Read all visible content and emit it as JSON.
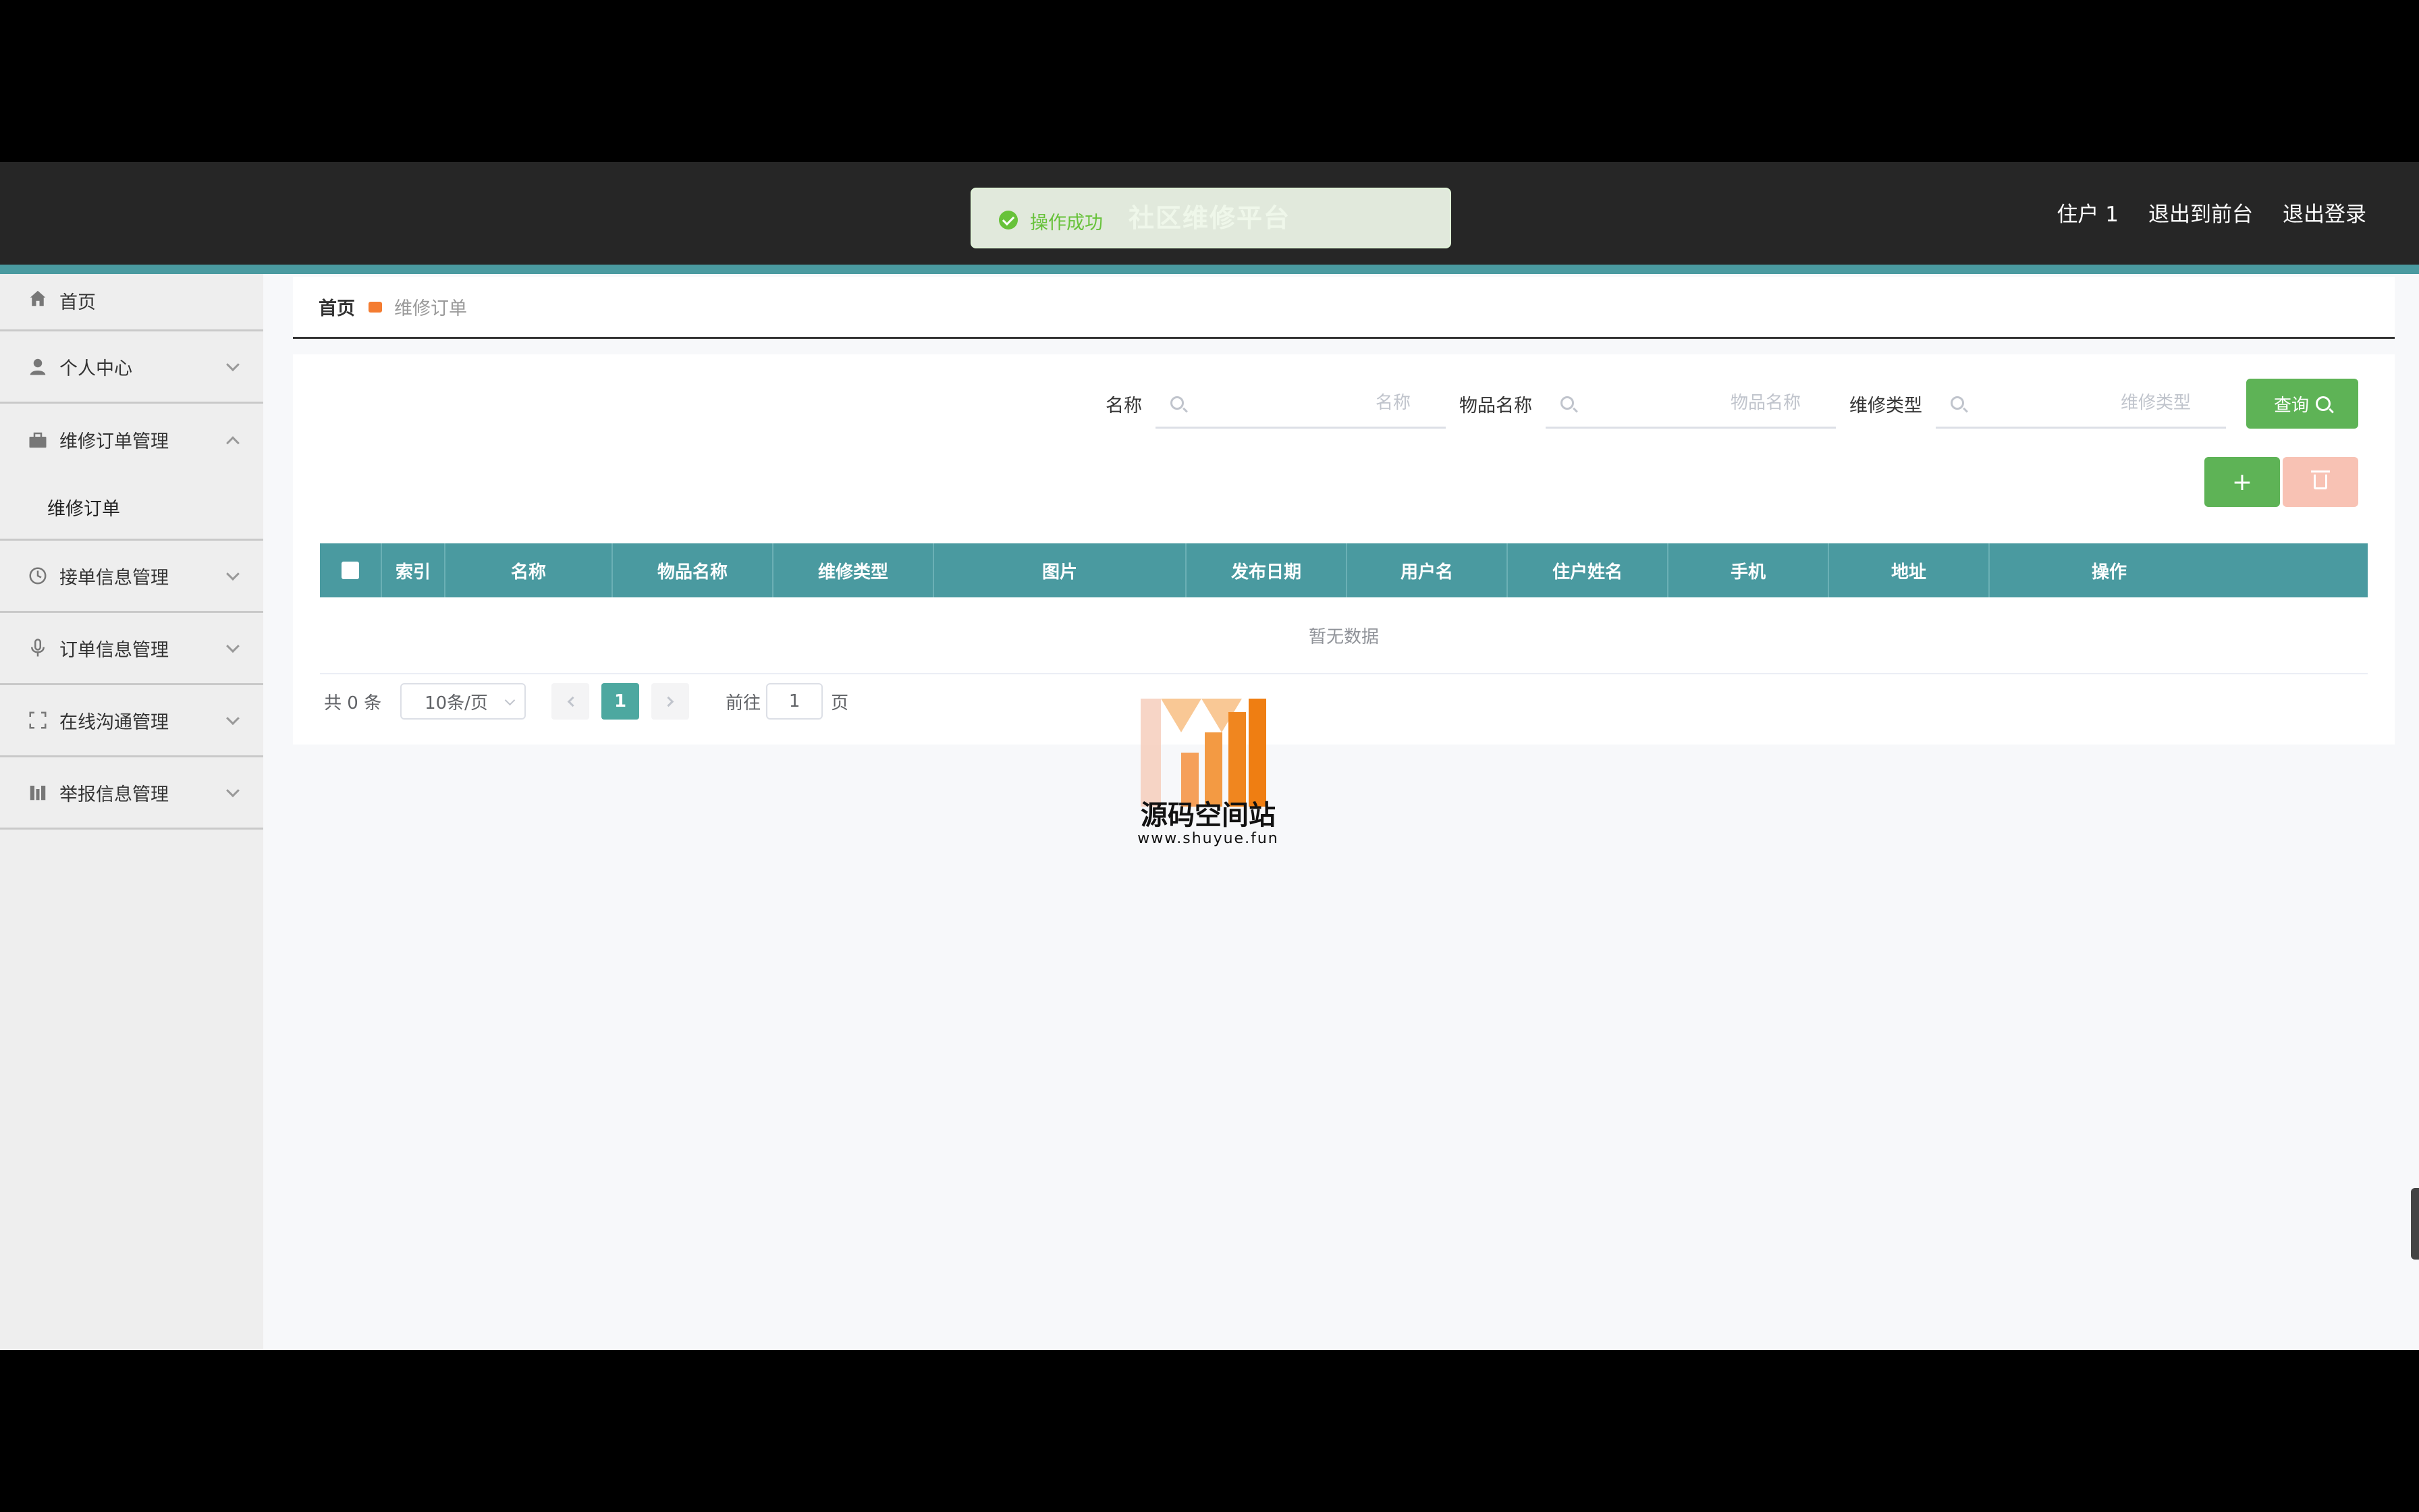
{
  "header": {
    "site_title": "社区维修平台",
    "links": [
      "住户 1",
      "退出到前台",
      "退出登录"
    ]
  },
  "toast": {
    "message": "操作成功",
    "color": "#67c23a"
  },
  "sidebar": {
    "items": [
      {
        "label": "首页",
        "icon": "home-icon"
      },
      {
        "label": "个人中心",
        "icon": "user-icon"
      },
      {
        "label": "维修订单管理",
        "icon": "briefcase-icon",
        "expanded": true,
        "children": [
          "维修订单"
        ]
      },
      {
        "label": "接单信息管理",
        "icon": "clock-icon"
      },
      {
        "label": "订单信息管理",
        "icon": "microphone-icon"
      },
      {
        "label": "在线沟通管理",
        "icon": "frame-icon"
      },
      {
        "label": "举报信息管理",
        "icon": "columns-icon"
      }
    ]
  },
  "breadcrumb": {
    "home": "首页",
    "current": "维修订单"
  },
  "search": {
    "fields": [
      {
        "label": "名称",
        "placeholder": "名称"
      },
      {
        "label": "物品名称",
        "placeholder": "物品名称"
      },
      {
        "label": "维修类型",
        "placeholder": "维修类型"
      }
    ],
    "query_label": "查询"
  },
  "actions": {
    "add_label": "+"
  },
  "table": {
    "columns": [
      "索引",
      "名称",
      "物品名称",
      "维修类型",
      "图片",
      "发布日期",
      "用户名",
      "住户姓名",
      "手机",
      "地址",
      "操作"
    ],
    "empty_text": "暂无数据"
  },
  "pagination": {
    "total_text": "共 0 条",
    "page_size": "10条/页",
    "current_page": "1",
    "goto_label": "前往",
    "goto_value": "1",
    "page_suffix": "页"
  },
  "watermark": {
    "name": "源码空间站",
    "url": "www.shuyue.fun"
  },
  "colors": {
    "header_bg": "#262626",
    "accent": "#4a9aa0",
    "primary_green": "#5eb356",
    "danger_light": "#f8c2b4"
  }
}
